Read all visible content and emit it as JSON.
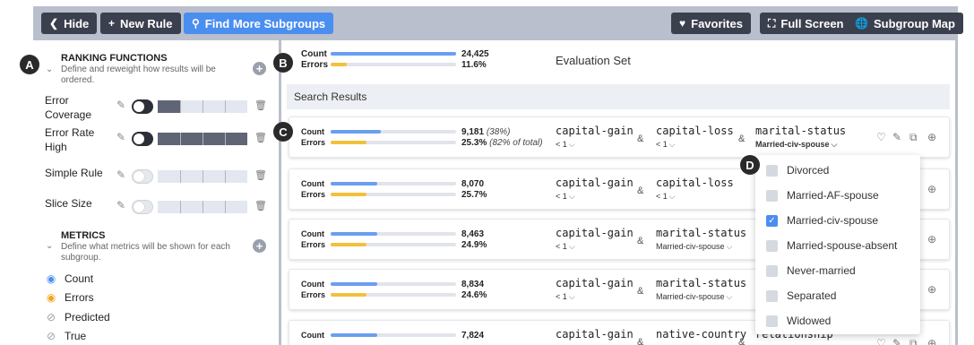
{
  "toolbar": {
    "hide": "Hide",
    "new_rule": "New Rule",
    "find_more": "Find More Subgroups",
    "favorites": "Favorites",
    "full_screen": "Full Screen",
    "subgroup_map": "Subgroup Map"
  },
  "callouts": {
    "a": "A",
    "b": "B",
    "c": "C",
    "d": "D"
  },
  "ranking": {
    "title": "RANKING FUNCTIONS",
    "desc_line1": "Define and reweight how results will be",
    "desc_line2": "ordered.",
    "items": [
      {
        "line1": "Error",
        "line2": "Coverage",
        "enabled": true,
        "weight": 0.25
      },
      {
        "line1": "Error Rate",
        "line2": "High",
        "enabled": true,
        "weight": 1.0
      },
      {
        "line1": "Simple Rule",
        "line2": "",
        "enabled": false,
        "weight": 0
      },
      {
        "line1": "Slice Size",
        "line2": "",
        "enabled": false,
        "weight": 0
      }
    ]
  },
  "metrics": {
    "title": "METRICS",
    "desc_line1": "Define what metrics will be shown for each",
    "desc_line2": "subgroup.",
    "items": [
      {
        "label": "Count",
        "visible": true,
        "color": "#4a8ef0"
      },
      {
        "label": "Errors",
        "visible": true,
        "color": "#f2a51a"
      },
      {
        "label": "Predicted",
        "visible": false,
        "color": "#9aa0ab"
      },
      {
        "label": "True",
        "visible": false,
        "color": "#9aa0ab"
      }
    ]
  },
  "evaluation": {
    "count_label": "Count",
    "errors_label": "Errors",
    "count": "24,425",
    "errors": "11.6%",
    "title": "Evaluation Set"
  },
  "search_results_label": "Search Results",
  "results": [
    {
      "count": "9,181",
      "count_sub": "(38%)",
      "errors": "25.3%",
      "errors_sub": "(82% of total)",
      "features": [
        {
          "name": "capital-gain",
          "value": "< 1"
        },
        {
          "name": "capital-loss",
          "value": "< 1"
        },
        {
          "name": "marital-status",
          "value": "Married-civ-spouse"
        }
      ]
    },
    {
      "count": "8,070",
      "count_sub": "",
      "errors": "25.7%",
      "errors_sub": "",
      "features": [
        {
          "name": "capital-gain",
          "value": "< 1"
        },
        {
          "name": "capital-loss",
          "value": "< 1"
        }
      ]
    },
    {
      "count": "8,463",
      "count_sub": "",
      "errors": "24.9%",
      "errors_sub": "",
      "features": [
        {
          "name": "capital-gain",
          "value": "< 1"
        },
        {
          "name": "marital-status",
          "value": "Married-civ-spouse"
        }
      ]
    },
    {
      "count": "8,834",
      "count_sub": "",
      "errors": "24.6%",
      "errors_sub": "",
      "features": [
        {
          "name": "capital-gain",
          "value": "< 1"
        },
        {
          "name": "marital-status",
          "value": "Married-civ-spouse"
        }
      ]
    },
    {
      "count": "7,824",
      "count_sub": "",
      "errors": "",
      "errors_sub": "",
      "features": [
        {
          "name": "capital-gain",
          "value": ""
        },
        {
          "name": "native-country",
          "value": ""
        },
        {
          "name": "relationship",
          "value": ""
        }
      ]
    }
  ],
  "dropdown_options": [
    {
      "label": "Divorced",
      "checked": false
    },
    {
      "label": "Married-AF-spouse",
      "checked": false
    },
    {
      "label": "Married-civ-spouse",
      "checked": true
    },
    {
      "label": "Married-spouse-absent",
      "checked": false
    },
    {
      "label": "Never-married",
      "checked": false
    },
    {
      "label": "Separated",
      "checked": false
    },
    {
      "label": "Widowed",
      "checked": false
    }
  ],
  "colors": {
    "accent": "#4a8ef0",
    "errors": "#f2c13b",
    "toolbar_dark": "#3b404e",
    "toolbar_bg": "#b9bfcc"
  }
}
